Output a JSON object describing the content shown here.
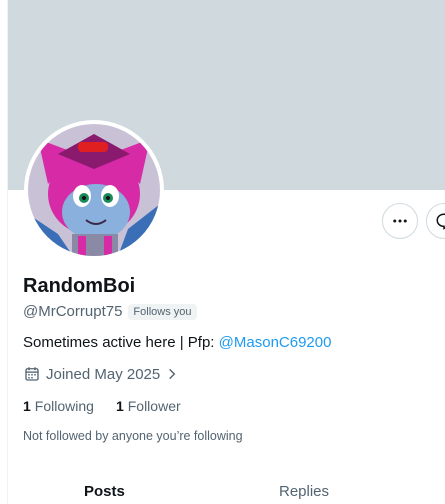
{
  "profile": {
    "display_name": "RandomBoi",
    "handle": "@MrCorrupt75",
    "follows_you_badge": "Follows you",
    "bio_prefix": "Sometimes active here | Pfp: ",
    "bio_mention": "@MasonC69200",
    "joined": "Joined May 2025",
    "following_count": "1",
    "following_label": "Following",
    "followers_count": "1",
    "followers_label": "Follower",
    "not_followed_note": "Not followed by anyone you’re following"
  },
  "tabs": [
    {
      "label": "Posts",
      "active": true
    },
    {
      "label": "Replies",
      "active": false
    }
  ],
  "icons": {
    "more": "more-horizontal-icon",
    "message": "message-icon",
    "calendar": "calendar-icon",
    "chevron": "chevron-right-icon"
  },
  "colors": {
    "banner": "#cfd9de",
    "link": "#1d9bf0",
    "muted": "#536471",
    "text": "#0f1419"
  }
}
